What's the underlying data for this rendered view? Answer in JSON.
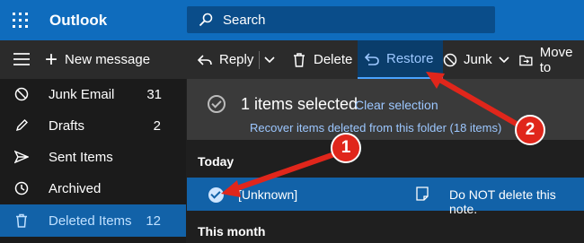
{
  "app": {
    "name": "Outlook"
  },
  "search": {
    "label": "Search"
  },
  "commands": {
    "new_message": "New message",
    "reply": "Reply",
    "delete": "Delete",
    "restore": "Restore",
    "junk": "Junk",
    "move_to": "Move to"
  },
  "folders": [
    {
      "name": "Junk Email",
      "count": "31",
      "icon": "block-icon"
    },
    {
      "name": "Drafts",
      "count": "2",
      "icon": "pencil-icon"
    },
    {
      "name": "Sent Items",
      "count": "",
      "icon": "send-icon"
    },
    {
      "name": "Archived",
      "count": "",
      "icon": "clock-icon"
    },
    {
      "name": "Deleted Items",
      "count": "12",
      "icon": "trash-icon",
      "active": true
    }
  ],
  "banner": {
    "selected_text": "1 items selected",
    "clear_selection": "Clear selection",
    "recover_link": "Recover items deleted from this folder (18 items)"
  },
  "list": {
    "groups": [
      "Today",
      "This month"
    ],
    "message": {
      "from": "[Unknown]",
      "subject": "Do NOT delete this note."
    }
  },
  "callouts": [
    "1",
    "2"
  ],
  "colors": {
    "accent": "#0f6cbd",
    "selected": "#1262a8",
    "callout": "#e0261b"
  }
}
